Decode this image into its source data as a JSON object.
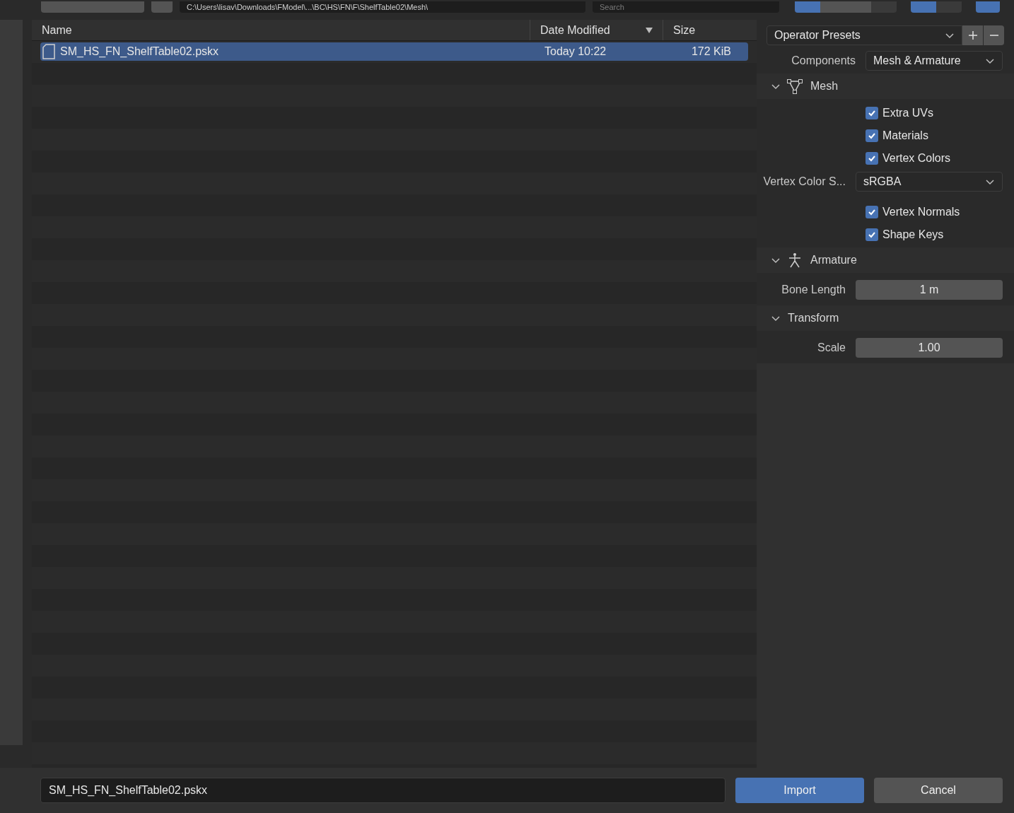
{
  "toolbar": {
    "path": "C:\\Users\\lisav\\Downloads\\FModel\\...\\BC\\HS\\FN\\F\\ShelfTable02\\Mesh\\",
    "search_placeholder": "Search",
    "view_modes": [
      {
        "selected": true
      },
      {
        "selected": false
      },
      {
        "selected": false
      }
    ],
    "filter_on": true
  },
  "file_list": {
    "columns": [
      {
        "label": "Name",
        "sorted": false
      },
      {
        "label": "Date Modified",
        "sorted": true
      },
      {
        "label": "Size",
        "sorted": false
      }
    ],
    "rows": [
      {
        "name": "SM_HS_FN_ShelfTable02.pskx",
        "date": "Today 10:22",
        "size": "172 KiB",
        "selected": true
      }
    ]
  },
  "options": {
    "presets": "Operator Presets",
    "components": {
      "label": "Components",
      "value": "Mesh & Armature"
    },
    "sections": [
      {
        "title": "Mesh",
        "expanded": true,
        "items": [
          {
            "kind": "checkbox",
            "label": "Extra UVs",
            "checked": true
          },
          {
            "kind": "checkbox",
            "label": "Materials",
            "checked": true
          },
          {
            "kind": "checkbox",
            "label": "Vertex Colors",
            "checked": true
          },
          {
            "kind": "select",
            "label": "Vertex Color S...",
            "value": "sRGBA"
          },
          {
            "kind": "checkbox",
            "label": "Vertex Normals",
            "checked": true
          },
          {
            "kind": "checkbox",
            "label": "Shape Keys",
            "checked": true
          }
        ]
      },
      {
        "title": "Armature",
        "expanded": true,
        "items": [
          {
            "kind": "number",
            "label": "Bone Length",
            "value": "1 m"
          }
        ]
      },
      {
        "title": "Transform",
        "expanded": true,
        "items": [
          {
            "kind": "number",
            "label": "Scale",
            "value": "1.00"
          }
        ]
      }
    ]
  },
  "footer": {
    "filename": "SM_HS_FN_ShelfTable02.pskx",
    "buttons": [
      {
        "label": "Import",
        "primary": true
      },
      {
        "label": "Cancel",
        "primary": false
      }
    ]
  }
}
